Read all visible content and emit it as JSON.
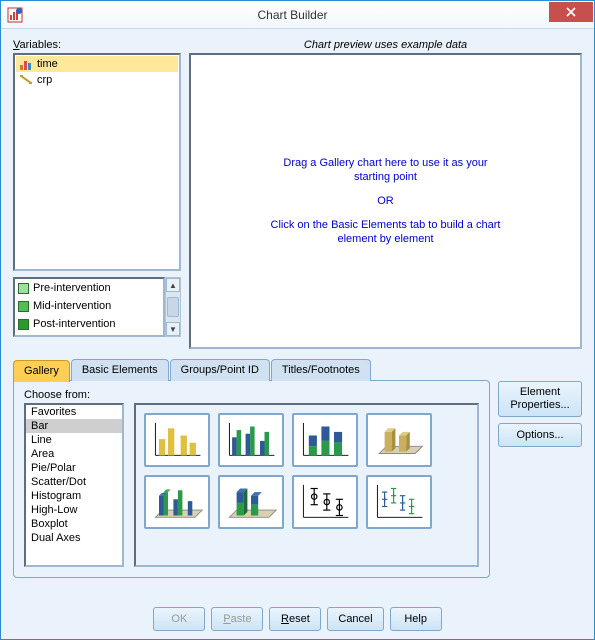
{
  "title": "Chart Builder",
  "vars_label": "Variables:",
  "preview_label": "Chart preview uses example data",
  "variables": [
    {
      "name": "time",
      "icon": "nominal-icon",
      "selected": true
    },
    {
      "name": "crp",
      "icon": "scale-icon",
      "selected": false
    }
  ],
  "categories": [
    {
      "label": "Pre-intervention",
      "color": "#6fc06f"
    },
    {
      "label": "Mid-intervention",
      "color": "#3aa63a"
    },
    {
      "label": "Post-intervention",
      "color": "#1f7a1f"
    }
  ],
  "preview_msg": {
    "l1": "Drag a Gallery chart here to use it as your",
    "l2": "starting point",
    "or": "OR",
    "l3": "Click on the Basic Elements tab to build a chart",
    "l4": "element by element"
  },
  "tabs": {
    "gallery": "Gallery",
    "basic": "Basic Elements",
    "groups": "Groups/Point ID",
    "titles": "Titles/Footnotes"
  },
  "choose_label": "Choose from:",
  "choose_list": [
    "Favorites",
    "Bar",
    "Line",
    "Area",
    "Pie/Polar",
    "Scatter/Dot",
    "Histogram",
    "High-Low",
    "Boxplot",
    "Dual Axes"
  ],
  "choose_selected": "Bar",
  "side_buttons": {
    "elprops_l1": "Element",
    "elprops_l2": "Properties...",
    "options": "Options..."
  },
  "bottom_buttons": {
    "ok": "OK",
    "paste": "Paste",
    "reset": "Reset",
    "cancel": "Cancel",
    "help": "Help"
  }
}
